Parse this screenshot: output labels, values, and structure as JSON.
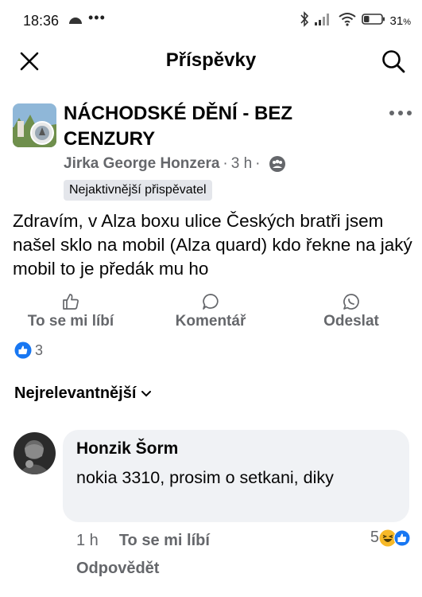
{
  "status_bar": {
    "time": "18:36",
    "dots": "•••",
    "battery_percent": "31",
    "battery_level": 0.31
  },
  "header": {
    "title": "Příspěvky"
  },
  "post": {
    "group_name": "NÁCHODSKÉ DĚNÍ - BEZ CENZURY",
    "author": "Jirka George Honzera",
    "separator": "·",
    "time": "3 h",
    "separator2": "·",
    "badge": "Nejaktivnější přispěvatel",
    "text": "Zdravím, v Alza boxu ulice Českých bratři jsem našel sklo na mobil (Alza quard) kdo řekne na jaký mobil to je předák mu ho",
    "actions": {
      "like": "To se mi líbí",
      "comment": "Komentář",
      "send": "Odeslat"
    },
    "reaction_count": "3"
  },
  "comments_sort": "Nejrelevantnější",
  "comment": {
    "author": "Honzik Šorm",
    "text": "nokia 3310, prosim o setkani, diky",
    "time": "1 h",
    "like": "To se mi líbí",
    "reply": "Odpovědět",
    "reaction_count": "5"
  },
  "colors": {
    "text": "#050505",
    "secondary": "#65676b",
    "bubble": "#f0f2f5",
    "like_blue": "#1877f2",
    "haha_yellow": "#f7b928"
  }
}
